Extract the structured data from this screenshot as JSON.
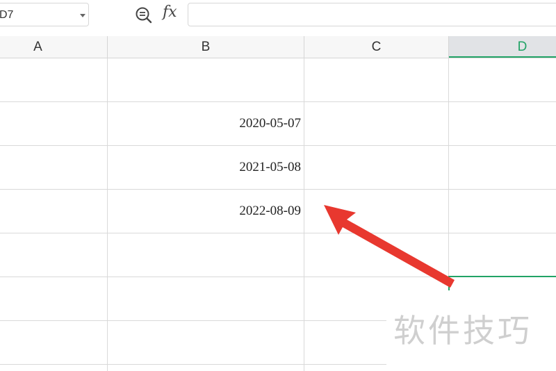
{
  "formula_bar": {
    "name_box_value": "D7",
    "zoom_icon": "zoom-out-icon",
    "fx_label": "fx",
    "formula_value": ""
  },
  "columns": [
    {
      "label": "A",
      "selected": false
    },
    {
      "label": "B",
      "selected": false
    },
    {
      "label": "C",
      "selected": false
    },
    {
      "label": "D",
      "selected": true
    }
  ],
  "cells": {
    "b_row2": "2020-05-07",
    "b_row3": "2021-05-08",
    "b_row4": "2022-08-09"
  },
  "active_cell": "D7",
  "annotation": {
    "arrow_color": "#e8382f",
    "arrow_icon": "red-arrow-pointer"
  },
  "accent_color": "#21a366",
  "watermark": "软件技巧"
}
